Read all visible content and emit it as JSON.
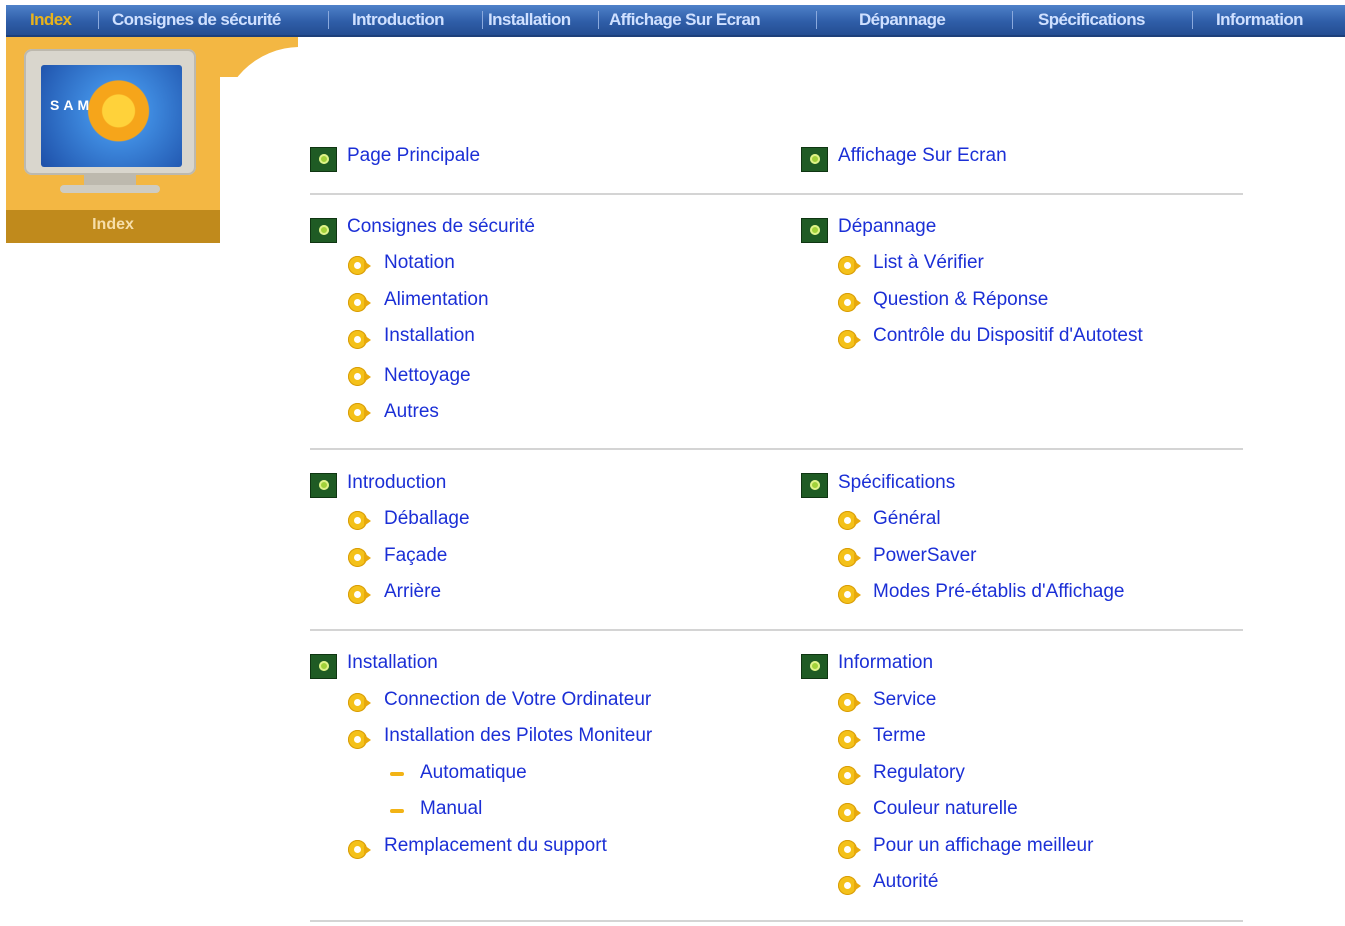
{
  "nav": {
    "items": [
      "Index",
      "Consignes de sécurité",
      "Introduction",
      "Installation",
      "Affichage Sur Ecran",
      "Dépannage",
      "Spécifications",
      "Information"
    ]
  },
  "panel": {
    "monitor_brand": "SAM",
    "label": "Index"
  },
  "sections": [
    {
      "title_left": "Page Principale",
      "title_right": "Affichage Sur Ecran",
      "rows": []
    },
    {
      "title_left": "Consignes de sécurité",
      "title_right": "Dépannage",
      "rows": [
        {
          "left": "Notation",
          "right": "List à Vérifier"
        },
        {
          "left": "Alimentation",
          "right": "Question & Réponse"
        },
        {
          "left": "Installation",
          "right": "Contrôle du Dispositif d'Autotest"
        },
        {
          "left": "Nettoyage",
          "right": ""
        },
        {
          "left": "Autres",
          "right": ""
        }
      ]
    },
    {
      "title_left": "Introduction",
      "title_right": "Spécifications",
      "rows": [
        {
          "left": "Déballage",
          "right": "Général"
        },
        {
          "left": "Façade",
          "right": "PowerSaver"
        },
        {
          "left": "Arrière",
          "right": "Modes Pré-établis d'Affichage"
        }
      ]
    },
    {
      "title_left": "Installation",
      "title_right": "Information",
      "rows": [
        {
          "left": "Connection de Votre Ordinateur",
          "right": "Service"
        },
        {
          "left": "Installation des Pilotes Moniteur",
          "right": "Terme"
        },
        {
          "left": "Automatique",
          "right": "Regulatory"
        },
        {
          "left": "Manual",
          "right": "Couleur naturelle"
        },
        {
          "left": "Remplacement du support",
          "right": "Pour un affichage meilleur"
        },
        {
          "left": "",
          "right": "Autorité"
        }
      ]
    }
  ]
}
